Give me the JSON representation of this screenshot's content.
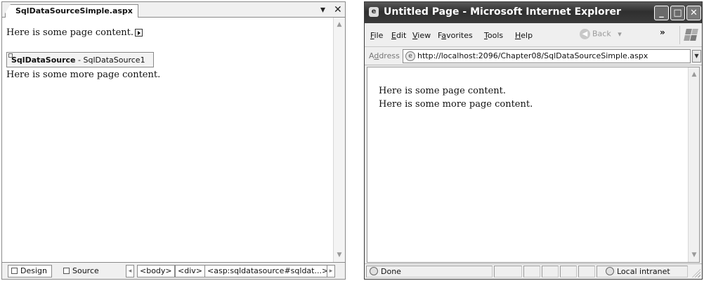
{
  "designer": {
    "tab_title": "SqlDataSourceSimple.aspx",
    "dropdown_glyph": "▾",
    "close_glyph": "✕",
    "line1": "Here is some page content.",
    "control_type": "SqlDataSource",
    "control_separator": " - ",
    "control_id": "SqlDataSource1",
    "line2": "Here is some more page content.",
    "view_buttons": {
      "design": "Design",
      "source": "Source"
    },
    "tag_path": [
      "<body>",
      "<div>",
      "<asp:sqldatasource#sqldat...>"
    ],
    "scroll_left": "◂",
    "scroll_right": "▸",
    "scroll_up": "▲",
    "scroll_down": "▼"
  },
  "browser": {
    "title": "Untitled Page - Microsoft Internet Explorer",
    "title_buttons": {
      "minimize": "_",
      "maximize": "□",
      "close": "✕"
    },
    "menu": [
      {
        "label_u": "F",
        "label_rest": "ile"
      },
      {
        "label_u": "E",
        "label_rest": "dit"
      },
      {
        "label_u": "V",
        "label_rest": "iew"
      },
      {
        "label_pre": "F",
        "label_u": "a",
        "label_rest": "vorites"
      },
      {
        "label_u": "T",
        "label_rest": "ools"
      },
      {
        "label_u": "H",
        "label_rest": "elp"
      }
    ],
    "back_label": "Back",
    "back_arrow": "◀",
    "back_dropdown": "▾",
    "more_chevron": "»",
    "address_label_pre": "A",
    "address_label_u": "d",
    "address_label_rest": "dress",
    "address_url": "http://localhost:2096/Chapter08/SqlDataSourceSimple.aspx",
    "address_dropdown": "▼",
    "content_line1": "Here is some page content.",
    "content_line2": "Here is some more page content.",
    "status_text": "Done",
    "zone_text": "Local intranet",
    "scroll_up": "▲",
    "scroll_down": "▼"
  },
  "icons": {
    "smart_tag": "smart-tag-arrow-icon",
    "design_view": "design-view-icon",
    "source_view": "source-view-icon",
    "ie_page": "ie-page-icon",
    "windows_logo": "windows-logo-icon",
    "intranet_zone": "local-intranet-icon"
  }
}
